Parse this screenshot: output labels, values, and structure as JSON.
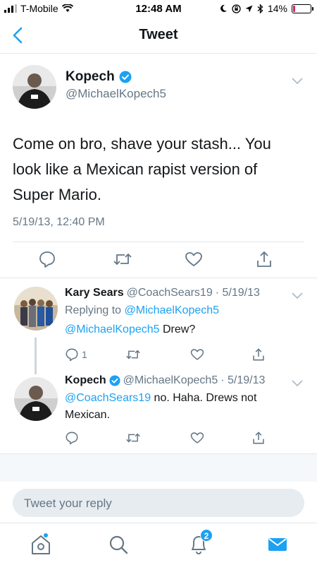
{
  "status_bar": {
    "carrier": "T-Mobile",
    "time": "12:48 AM",
    "battery_percent": "14%",
    "battery_level": 0.14,
    "battery_color": "#e0245e"
  },
  "header": {
    "title": "Tweet",
    "back_icon": "chevron-left-icon"
  },
  "main_tweet": {
    "name": "Kopech",
    "verified": true,
    "handle": "@MichaelKopech5",
    "text": "Come on bro, shave your stash... You look like a Mexican rapist version of Super Mario.",
    "timestamp": "5/19/13, 12:40 PM",
    "actions": [
      "reply-icon",
      "retweet-icon",
      "like-icon",
      "share-icon"
    ]
  },
  "replies": [
    {
      "name": "Kary Sears",
      "handle": "@CoachSears19",
      "date": "· 5/19/13",
      "replying_label": "Replying to",
      "replying_to": "@MichaelKopech5",
      "mention": "@MichaelKopech5",
      "text": " Drew?",
      "reply_count": "1"
    },
    {
      "name": "Kopech",
      "verified": true,
      "handle": "@MichaelKopech5",
      "date": "· 5/19/13",
      "mention": "@CoachSears19",
      "text_line1": " no. Haha. Drews not",
      "text_line2": "Mexican."
    }
  ],
  "reply_box": {
    "placeholder": "Tweet your reply"
  },
  "tab_bar": {
    "tabs": [
      "home-icon",
      "search-icon",
      "notifications-icon",
      "messages-icon"
    ],
    "notification_badge": "2"
  },
  "colors": {
    "accent": "#1da1f2",
    "text": "#14171a",
    "muted": "#657786",
    "divider": "#e1e8ed"
  }
}
